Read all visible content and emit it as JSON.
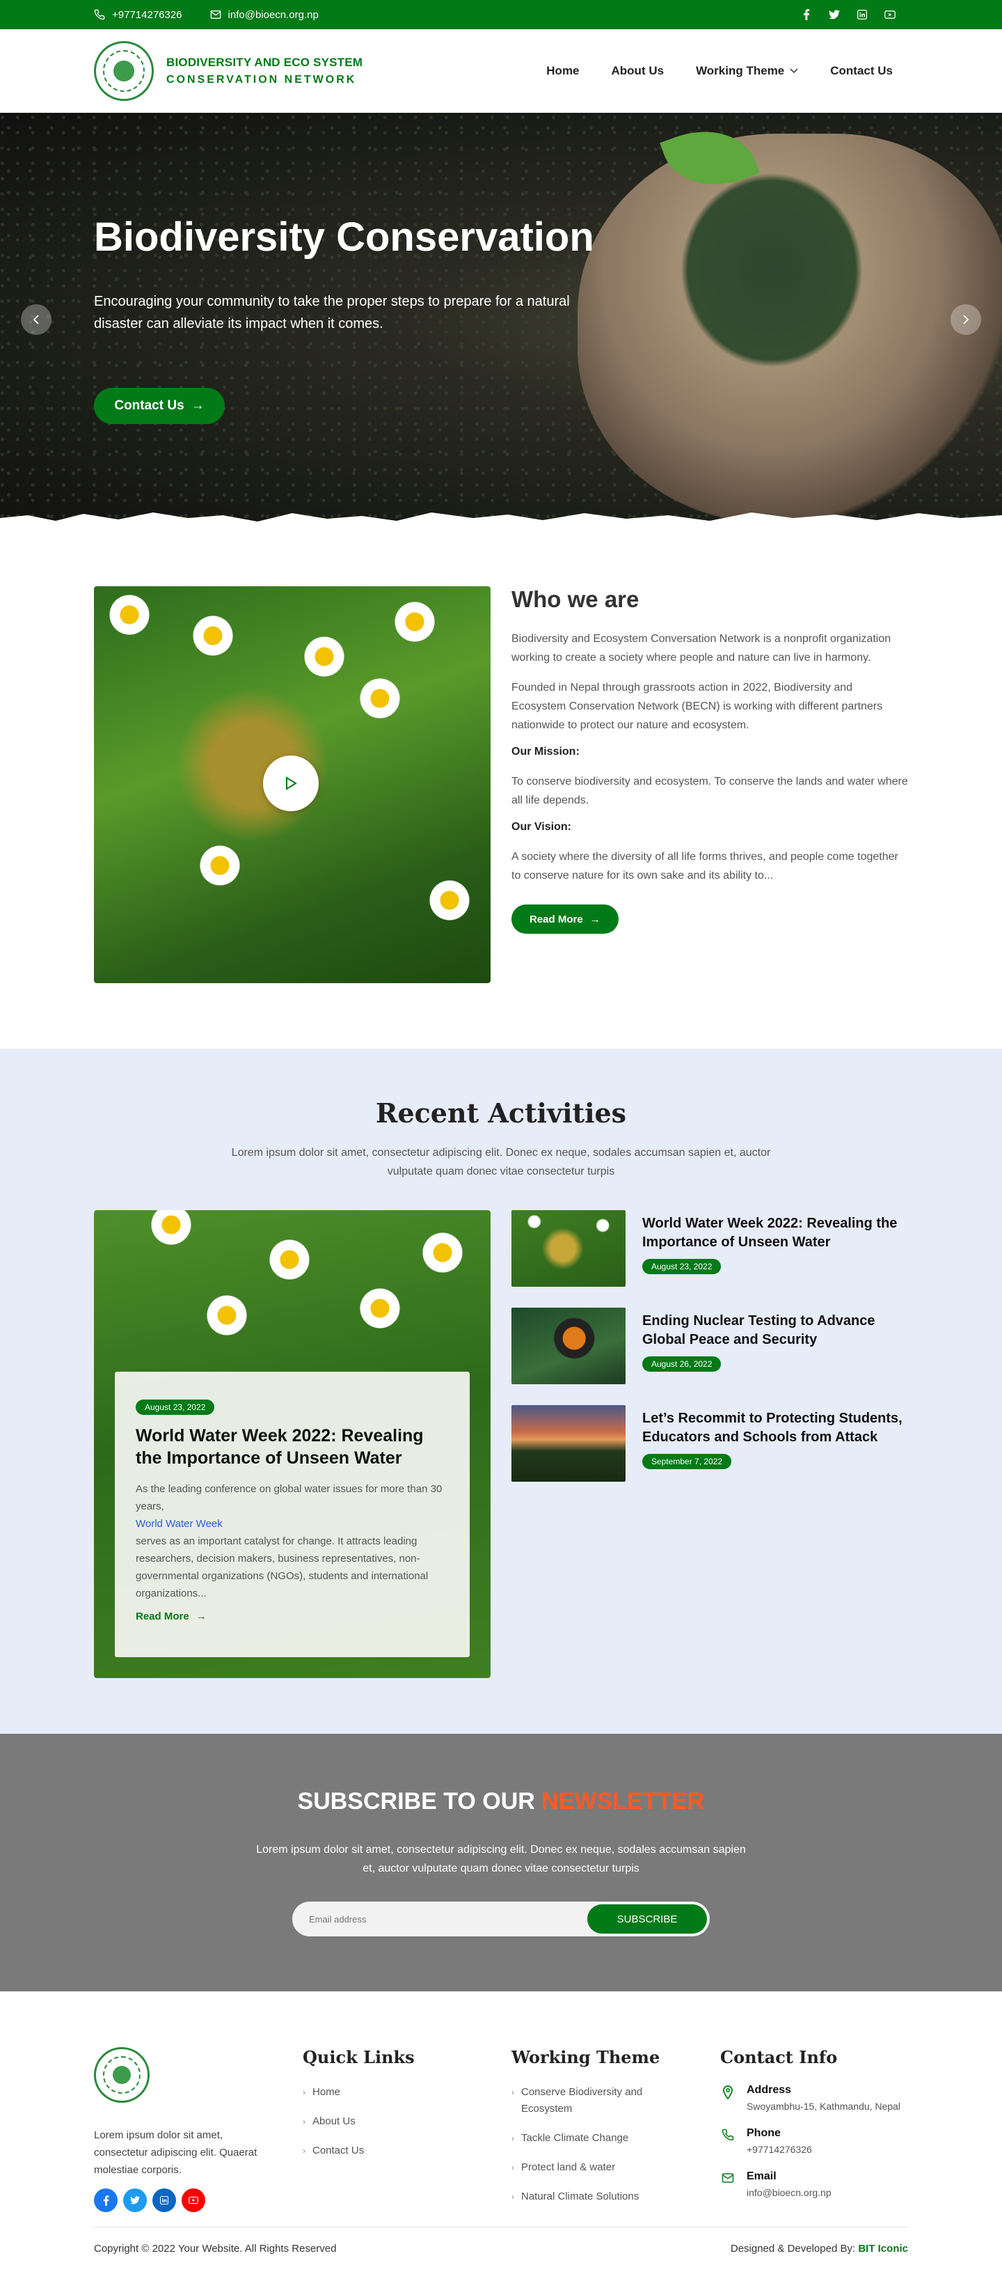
{
  "topbar": {
    "phone": "+97714276326",
    "email": "info@bioecn.org.np",
    "social": [
      "facebook-icon",
      "twitter-icon",
      "linkedin-icon",
      "youtube-icon"
    ]
  },
  "header": {
    "brand_line1": "BIODIVERSITY AND ECO SYSTEM",
    "brand_line2": "CONSERVATION NETWORK",
    "nav": [
      {
        "label": "Home"
      },
      {
        "label": "About Us"
      },
      {
        "label": "Working Theme"
      },
      {
        "label": "Contact Us"
      }
    ]
  },
  "hero": {
    "title": "Biodiversity Conservation",
    "text": "Encouraging your community to take the proper steps to prepare for a natural disaster can alleviate its impact when it comes.",
    "cta": "Contact Us"
  },
  "who": {
    "title": "Who we are",
    "p1": "Biodiversity and Ecosystem Conversation Network is a nonprofit organization working to create a society where people and nature can live in harmony.",
    "p2": "Founded in Nepal through grassroots action in 2022, Biodiversity and Ecosystem Conservation Network (BECN) is working with different partners nationwide to protect our nature and ecosystem.",
    "mission_label": "Our Mission:",
    "mission": "To conserve biodiversity and ecosystem. To conserve the lands and water where all life depends.",
    "vision_label": "Our Vision:",
    "vision": "A society where the diversity of all life forms thrives, and people come together to conserve nature for its own sake and its ability to...",
    "read_more": "Read More"
  },
  "recent": {
    "title": "Recent Activities",
    "subtitle": "Lorem ipsum dolor sit amet, consectetur adipiscing elit. Donec ex neque, sodales accumsan sapien et, auctor vulputate quam donec vitae consectetur turpis",
    "featured": {
      "date": "August 23, 2022",
      "title": "World Water Week 2022: Revealing the Importance of Unseen Water",
      "text1": "As the leading conference on global water issues for more than 30 years,",
      "link": "World Water Week",
      "text2": "serves as an important catalyst for change. It attracts leading researchers, decision makers, business representatives, non-governmental organizations (NGOs), students and international organizations...",
      "read_more": "Read More"
    },
    "list": [
      {
        "title": "World Water Week 2022: Revealing the Importance of Unseen Water",
        "date": "August 23, 2022"
      },
      {
        "title": "Ending Nuclear Testing to Advance Global Peace and Security",
        "date": "August 26, 2022"
      },
      {
        "title": "Let’s Recommit to Protecting Students, Educators and Schools from Attack",
        "date": "September 7, 2022"
      }
    ]
  },
  "newsletter": {
    "title": "SUBSCRIBE TO OUR",
    "highlight": "NEWSLETTER",
    "text": "Lorem ipsum dolor sit amet, consectetur adipiscing elit. Donec ex neque, sodales accumsan sapien et, auctor vulputate quam donec vitae consectetur turpis",
    "placeholder": "Email address",
    "button": "SUBSCRIBE"
  },
  "footer": {
    "about": "Lorem ipsum dolor sit amet, consectetur adipiscing elit. Quaerat molestiae corporis.",
    "quick_title": "Quick Links",
    "quick": [
      "Home",
      "About Us",
      "Contact Us"
    ],
    "theme_title": "Working Theme",
    "themes": [
      "Conserve Biodiversity and Ecosystem",
      "Tackle Climate Change",
      "Protect land & water",
      "Natural Climate Solutions"
    ],
    "contact_title": "Contact Info",
    "address_label": "Address",
    "address": "Swoyambhu-15, Kathmandu, Nepal",
    "phone_label": "Phone",
    "phone": "+97714276326",
    "email_label": "Email",
    "email": "info@bioecn.org.np",
    "copyright": "Copyright © 2022 Your Website. All Rights Reserved",
    "designed_by": "Designed & Developed By:",
    "developer": "BIT Iconic"
  },
  "colors": {
    "brand_green": "#037a18",
    "accent_orange": "#ff5a26",
    "activities_bg": "#e6ecf8",
    "newsletter_bg": "#7a7a7a"
  }
}
